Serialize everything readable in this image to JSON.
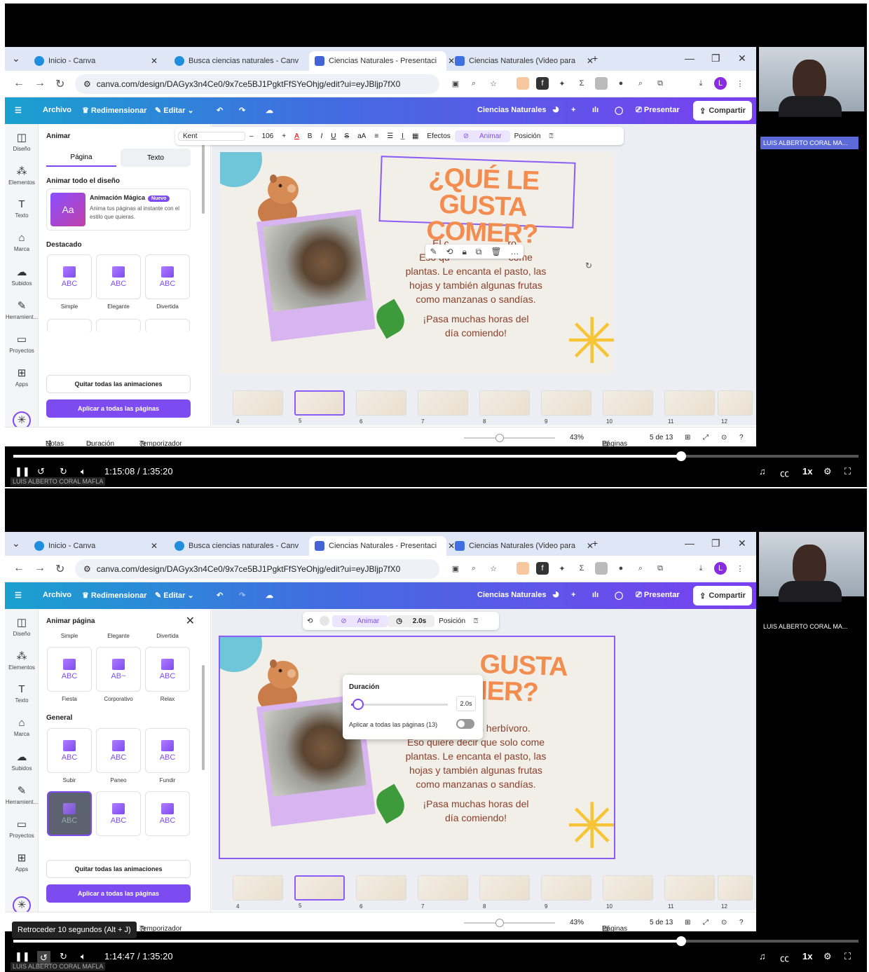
{
  "browser": {
    "tabs": [
      "Inicio - Canva",
      "Busca ciencias naturales - Canv",
      "Ciencias Naturales - Presentaci",
      "Ciencias Naturales (Video para"
    ],
    "url": "canva.com/design/DAGyx3n4Ce0/9x7ce5BJ1PgktFfSYeOhjg/edit?ui=eyJBljp7fX0"
  },
  "canva": {
    "menu": "Archivo",
    "resize": "Redimensionar",
    "edit": "Editar",
    "design_name": "Ciencias Naturales",
    "present": "Presentar",
    "share": "Compartir",
    "rail": [
      "Diseño",
      "Elementos",
      "Texto",
      "Marca",
      "Subidos",
      "Herramient...",
      "Proyectos",
      "Apps"
    ],
    "status": {
      "notes": "Notas",
      "duration": "Duración",
      "timer": "Temporizador",
      "zoom": "43%",
      "pages": "Páginas",
      "page_of": "5 de 13"
    },
    "thumb_numbers": [
      "4",
      "5",
      "6",
      "7",
      "8",
      "9",
      "10",
      "11",
      "12"
    ]
  },
  "slide": {
    "title_line1": "¿QUÉ LE GUSTA",
    "title_line2": "COMER?",
    "title_line1_partial": "GUSTA",
    "body_lines": [
      "El capibara es herbívoro.",
      "Eso quiere decir que solo come",
      "plantas. Le encanta el pasto, las",
      "hojas y también algunas frutas",
      "como manzanas o sandías."
    ],
    "body_lines_partial_1": "El c            ro.",
    "body_lines_partial_2": "Eso qu            come",
    "closing_lines": [
      "¡Pasa muchas horas del",
      "día comiendo!"
    ]
  },
  "frame1": {
    "toolbar": {
      "font": "Kent",
      "size": "106",
      "effects": "Efectos",
      "animate": "Animar",
      "position": "Posición"
    },
    "panel": {
      "title": "Animar",
      "tab_page": "Página",
      "tab_text": "Texto",
      "animate_all": "Animar todo el diseño",
      "magic_title": "Animación Mágica",
      "magic_badge": "Nuevo",
      "magic_desc": "Anima tus páginas al instante con el estilo que quieras.",
      "featured": "Destacado",
      "cards": [
        "Simple",
        "Elegante",
        "Divertida"
      ],
      "remove_all": "Quitar todas las animaciones",
      "apply_all": "Aplicar a todas las páginas"
    },
    "video": {
      "time": "1:15:08 / 1:35:20",
      "progress_fraction": 0.79
    }
  },
  "frame2": {
    "toolbar": {
      "animate": "Animar",
      "duration": "2.0s",
      "position": "Posición"
    },
    "duration_popup": {
      "label": "Duración",
      "value": "2.0s",
      "apply_all": "Aplicar a todas las páginas (13)",
      "slider_fraction": 0.07
    },
    "panel": {
      "title": "Animar página",
      "top_labels": [
        "Simple",
        "Elegante",
        "Divertida"
      ],
      "row1": [
        "Fiesta",
        "Corporativo",
        "Relax"
      ],
      "general": "General",
      "row2": [
        "Subir",
        "Paneo",
        "Fundir"
      ],
      "remove_all": "Quitar todas las animaciones",
      "apply_all": "Aplicar a todas las páginas"
    },
    "video": {
      "time": "1:14:47 / 1:35:20",
      "progress_fraction": 0.79
    },
    "tooltip": "Retroceder 10 segundos (Alt + J)"
  },
  "speaker": {
    "name_short": "LUIS ALBERTO CORAL MA...",
    "name_full": "LUIS ALBERTO CORAL MAFLA"
  },
  "player": {
    "speed": "1x"
  },
  "colors": {
    "accent": "#7d4bf0",
    "title": "#f28c4f",
    "body": "#8b3f2a"
  }
}
